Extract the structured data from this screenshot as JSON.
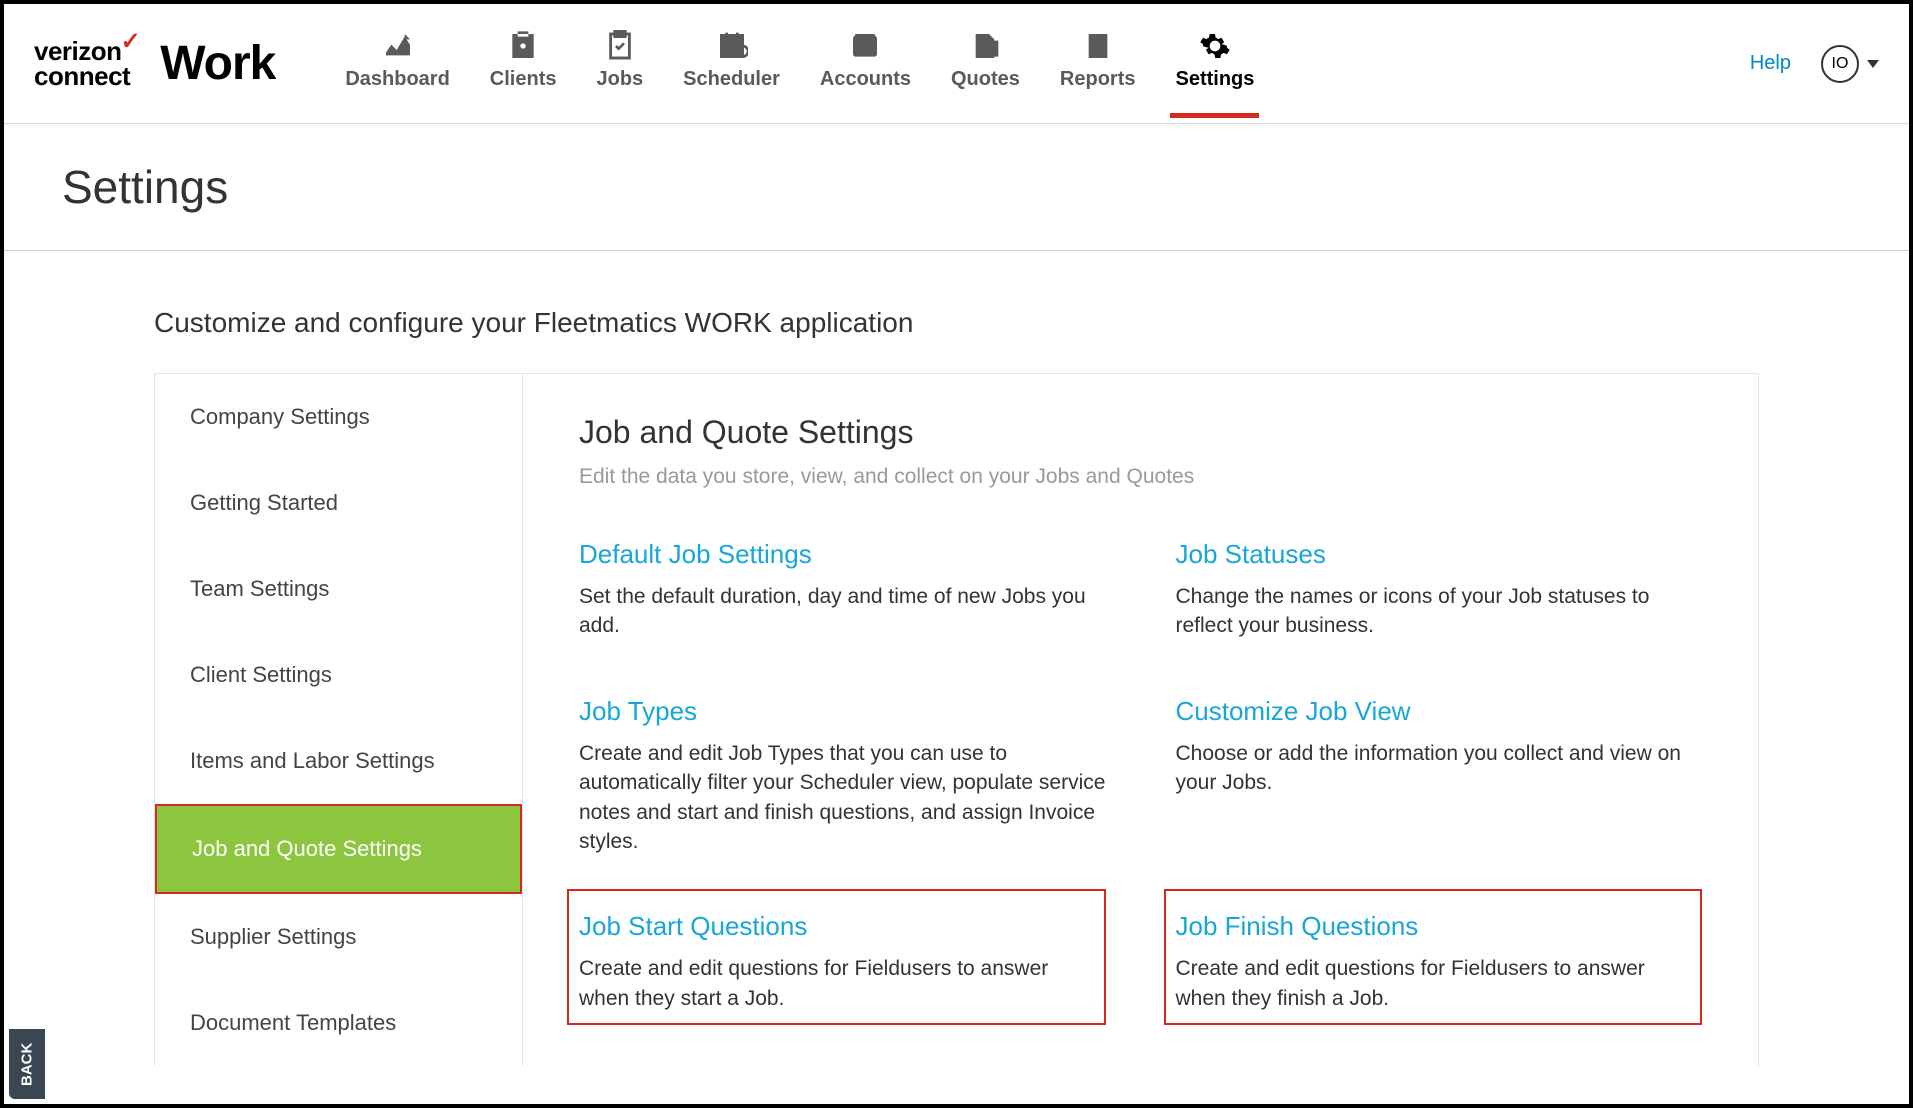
{
  "brand": {
    "verizon_line1": "verizon",
    "verizon_line2": "connect",
    "product": "Work"
  },
  "nav": {
    "items": [
      {
        "label": "Dashboard"
      },
      {
        "label": "Clients"
      },
      {
        "label": "Jobs"
      },
      {
        "label": "Scheduler"
      },
      {
        "label": "Accounts"
      },
      {
        "label": "Quotes"
      },
      {
        "label": "Reports"
      },
      {
        "label": "Settings"
      }
    ],
    "help_label": "Help",
    "user_initials": "IO"
  },
  "page": {
    "title": "Settings",
    "subtitle": "Customize and configure your Fleetmatics WORK application"
  },
  "sidebar": {
    "items": [
      {
        "label": "Company Settings"
      },
      {
        "label": "Getting Started"
      },
      {
        "label": "Team Settings"
      },
      {
        "label": "Client Settings"
      },
      {
        "label": "Items and Labor Settings"
      },
      {
        "label": "Job and Quote Settings"
      },
      {
        "label": "Supplier Settings"
      },
      {
        "label": "Document Templates"
      }
    ]
  },
  "panel": {
    "heading": "Job and Quote Settings",
    "subtext": "Edit the data you store, view, and collect on your Jobs and Quotes",
    "cards": [
      {
        "title": "Default Job Settings",
        "desc": "Set the default duration, day and time of new Jobs you add."
      },
      {
        "title": "Job Statuses",
        "desc": "Change the names or icons of your Job statuses to reflect your business."
      },
      {
        "title": "Job Types",
        "desc": "Create and edit Job Types that you can use to automatically filter your Scheduler view, populate service notes and start and finish questions, and assign Invoice styles."
      },
      {
        "title": "Customize Job View",
        "desc": "Choose or add the information you collect and view on your Jobs."
      },
      {
        "title": "Job Start Questions",
        "desc": "Create and edit questions for Fieldusers to answer when they start a Job."
      },
      {
        "title": "Job Finish Questions",
        "desc": "Create and edit questions for Fieldusers to answer when they finish a Job."
      }
    ]
  },
  "back_tab": "BACK"
}
